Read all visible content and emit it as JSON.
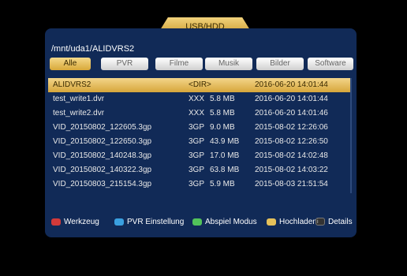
{
  "window": {
    "title": "USB/HDD"
  },
  "path": "/mnt/uda1/ALIDVRS2",
  "tabs": [
    {
      "label": "Alle"
    },
    {
      "label": "PVR"
    },
    {
      "label": "Filme"
    },
    {
      "label": "Musik"
    },
    {
      "label": "Bilder"
    },
    {
      "label": "Software"
    }
  ],
  "files": [
    {
      "name": "ALIDVRS2",
      "type": "<DIR>",
      "size": "",
      "date": "2016-06-20 14:01:44"
    },
    {
      "name": "test_write1.dvr",
      "type": "XXX",
      "size": "5.8 MB",
      "date": "2016-06-20 14:01:44"
    },
    {
      "name": "test_write2.dvr",
      "type": "XXX",
      "size": "5.8 MB",
      "date": "2016-06-20 14:01:46"
    },
    {
      "name": "VID_20150802_122605.3gp",
      "type": "3GP",
      "size": "9.0 MB",
      "date": "2015-08-02 12:26:06"
    },
    {
      "name": "VID_20150802_122650.3gp",
      "type": "3GP",
      "size": "43.9 MB",
      "date": "2015-08-02 12:26:50"
    },
    {
      "name": "VID_20150802_140248.3gp",
      "type": "3GP",
      "size": "17.0 MB",
      "date": "2015-08-02 14:02:48"
    },
    {
      "name": "VID_20150802_140322.3gp",
      "type": "3GP",
      "size": "63.8 MB",
      "date": "2015-08-02 14:03:22"
    },
    {
      "name": "VID_20150803_215154.3gp",
      "type": "3GP",
      "size": "5.9 MB",
      "date": "2015-08-03 21:51:54"
    }
  ],
  "footer": {
    "red": "Werkzeug",
    "blue": "PVR Einstellung",
    "green": "Abspiel Modus",
    "yellow": "Hochladen",
    "info": "Details"
  },
  "colors": {
    "red": "#d23a3a",
    "blue": "#3aa0e0",
    "green": "#52c25a",
    "yellow": "#e6c15a"
  }
}
